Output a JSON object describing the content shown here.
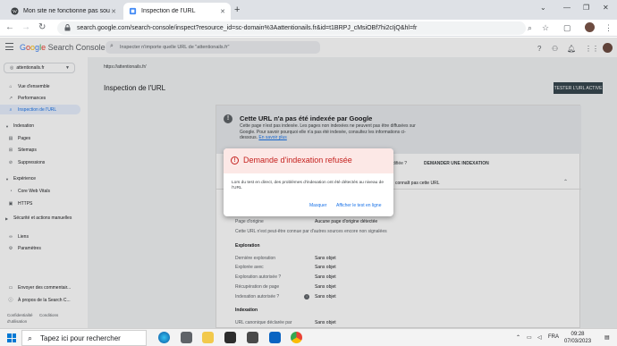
{
  "browser": {
    "tabs": [
      {
        "title": "Mon site ne fonctionne pas sou",
        "active": false
      },
      {
        "title": "Inspection de l'URL",
        "active": true
      }
    ],
    "url": "search.google.com/search-console/inspect?resource_id=sc-domain%3Aattentionails.fr&id=t1BRPJ_cMsiOBf7hi2cIjQ&hl=fr"
  },
  "gsc": {
    "logo_google": "Google",
    "logo_product": "Search Console",
    "search_placeholder": "Inspecter n'importe quelle URL de \"attentionails.fr\"",
    "property": "attentionails.fr",
    "inspected_url": "https://attentionails.fr/",
    "page_title": "Inspection de l'URL",
    "test_button": "TESTER L'URL ACTIVE"
  },
  "sidebar": {
    "items_top": [
      {
        "label": "Vue d'ensemble",
        "icon": "home-icon"
      },
      {
        "label": "Performances",
        "icon": "trend-icon"
      },
      {
        "label": "Inspection de l'URL",
        "icon": "search-icon",
        "active": true
      }
    ],
    "sections": [
      {
        "title": "Indexation",
        "items": [
          {
            "label": "Pages",
            "icon": "pages-icon"
          },
          {
            "label": "Sitemaps",
            "icon": "sitemap-icon"
          },
          {
            "label": "Suppressions",
            "icon": "remove-icon"
          }
        ]
      },
      {
        "title": "Expérience",
        "items": [
          {
            "label": "Core Web Vitals",
            "icon": "gauge-icon"
          },
          {
            "label": "HTTPS",
            "icon": "lock-icon"
          }
        ]
      },
      {
        "title": "Sécurité et actions manuelles",
        "items": []
      }
    ],
    "items_bottom": [
      {
        "label": "Liens",
        "icon": "link-icon"
      },
      {
        "label": "Paramètres",
        "icon": "gear-icon"
      }
    ],
    "footer_items": [
      {
        "label": "Envoyer des commentair...",
        "icon": "feedback-icon"
      },
      {
        "label": "À propos de la Search C...",
        "icon": "info-icon"
      }
    ],
    "legal": [
      "Confidentialité",
      "Conditions",
      "d'utilisation"
    ]
  },
  "card": {
    "status_title": "Cette URL n'a pas été indexée par Google",
    "status_desc": "Cette page n'est pas indexée. Les pages non indexées ne peuvent pas être diffusées sur Google. Pour savoir pourquoi elle n'a pas été indexée, consultez les informations ci-dessous.",
    "learn_more": "En savoir plus",
    "modified_link": "modifiée ?",
    "request_indexing": "DEMANDER UNE INDEXATION",
    "coverage_title": "connaît pas cette URL",
    "details": [
      {
        "label": "Page d'origine",
        "value": "Aucune page d'origine détectée"
      },
      {
        "label": "Cette URL n'est peut-être connue par d'autres sources encore non signalées",
        "value": ""
      }
    ],
    "exploration_title": "Exploration",
    "exploration": [
      {
        "label": "Dernière exploration",
        "value": "Sans objet"
      },
      {
        "label": "Explorée avec",
        "value": "Sans objet"
      },
      {
        "label": "Exploration autorisée ?",
        "value": "Sans objet"
      },
      {
        "label": "Récupération de page",
        "value": "Sans objet"
      },
      {
        "label": "Indexation autorisée ?",
        "value": "Sans objet"
      }
    ],
    "indexation_title": "Indexation",
    "indexation": [
      {
        "label": "URL canonique déclarée par",
        "value": "Sans objet"
      }
    ]
  },
  "dialog": {
    "title": "Demande d'indexation refusée",
    "body": "Lors du test en direct, des problèmes d'indexation ont été détectés au niveau de l'URL",
    "dismiss": "Masquer",
    "view_test": "Afficher le test en ligne"
  },
  "taskbar": {
    "search_placeholder": "Tapez ici pour rechercher",
    "language": "FRA",
    "time": "09:28",
    "date": "07/03/2023"
  }
}
